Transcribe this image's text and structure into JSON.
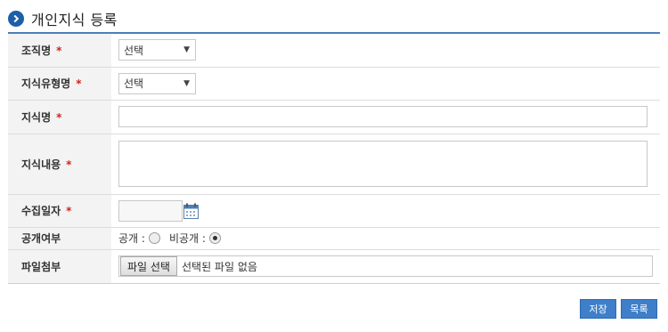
{
  "page": {
    "title": "개인지식 등록"
  },
  "form": {
    "org": {
      "label": "조직명",
      "required": "*",
      "value": "선택"
    },
    "type": {
      "label": "지식유형명",
      "required": "*",
      "value": "선택"
    },
    "name": {
      "label": "지식명",
      "required": "*",
      "value": ""
    },
    "content": {
      "label": "지식내용",
      "required": "*",
      "value": ""
    },
    "date": {
      "label": "수집일자",
      "required": "*",
      "value": ""
    },
    "visibility": {
      "label": "공개여부",
      "public_label": "공개 :",
      "private_label": "비공개 :",
      "selected": "비공개"
    },
    "attachment": {
      "label": "파일첨부",
      "button_label": "파일 선택",
      "status": "선택된 파일 없음"
    }
  },
  "actions": {
    "save_label": "저장",
    "list_label": "목록"
  },
  "colors": {
    "accent": "#1d5fa8",
    "button": "#3f7fc9",
    "required": "#d0231d",
    "label_bg": "#f3f3f3"
  },
  "icons": {
    "title": "chevron-right-circle-icon",
    "date": "calendar-icon",
    "select": "triangle-down-icon"
  }
}
